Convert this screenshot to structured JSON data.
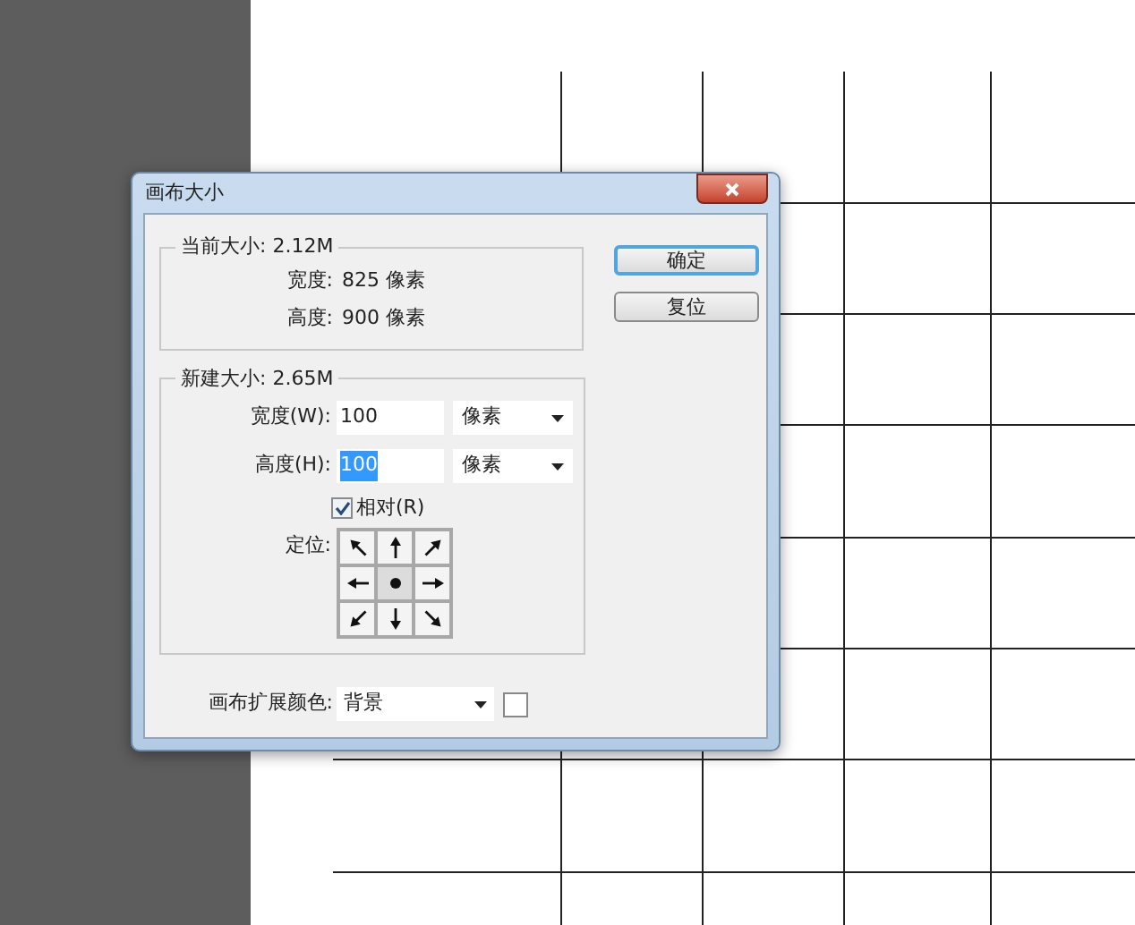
{
  "dialog": {
    "title": "画布大小",
    "current_size": {
      "legend": "当前大小: 2.12M",
      "rows": [
        {
          "label": "宽度:",
          "value": "825 像素"
        },
        {
          "label": "高度:",
          "value": "900 像素"
        }
      ]
    },
    "new_size": {
      "legend": "新建大小: 2.65M",
      "fields": [
        {
          "label": "宽度(W):",
          "value": "100",
          "selected": false,
          "unit": "像素"
        },
        {
          "label": "高度(H):",
          "value": "100",
          "selected": true,
          "unit": "像素"
        }
      ],
      "relative": {
        "label": "相对(R)",
        "checked": true
      },
      "anchor": {
        "label": "定位:",
        "cells": [
          {
            "selected": false
          },
          {
            "selected": false
          },
          {
            "selected": false
          },
          {
            "selected": false
          },
          {
            "selected": true
          },
          {
            "selected": false
          },
          {
            "selected": false
          },
          {
            "selected": false
          },
          {
            "selected": false
          }
        ]
      }
    },
    "extension_color": {
      "label": "画布扩展颜色:",
      "value": "背景",
      "color": "#ffffff"
    },
    "buttons": [
      {
        "label": "确定",
        "default": true
      },
      {
        "label": "复位",
        "default": false
      }
    ]
  }
}
